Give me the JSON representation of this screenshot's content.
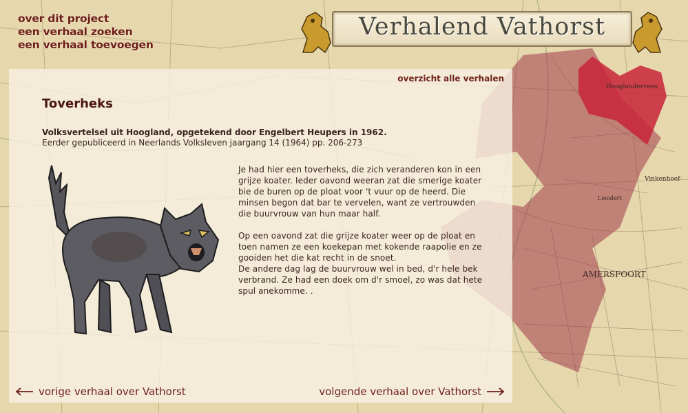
{
  "nav": {
    "items": [
      "over dit project",
      "een verhaal zoeken",
      "een verhaal toevoegen"
    ]
  },
  "logo": {
    "title": "Verhalend Vathorst"
  },
  "panel": {
    "overview_link": "overzicht alle verhalen",
    "title": "Toverheks",
    "subtitle_bold": "Volksvertelsel uit Hoogland, opgetekend door Engelbert Heupers in 1962.",
    "subtitle_plain": "Eerder gepubliceerd in Neerlands Volksleven jaargang 14 (1964) pp. 206-273",
    "story": [
      "Je had hier een toverheks, die zich veranderen kon in een grijze koater. Ieder oavond weeran zat die smerige koater bie de buren op de ploat voor 't vuur op de heerd. Die minsen begon dat bar te vervelen, want ze vertrouwden die buurvrouw van hun maar half.",
      "Op een oavond zat die grijze koater weer op de ploat en toen namen ze een koekepan met kokende raapolie en ze gooiden het die kat recht in de snoet.",
      "De andere dag lag de buurvrouw wel in bed, d'r hele bek verbrand. Ze had een doek om d'r smoel, zo was dat hete spul anekomme. ."
    ],
    "prev_link": "vorige verhaal over Vathorst",
    "next_link": "volgende verhaal over Vathorst"
  },
  "map_labels": [
    "Hooglanderveen",
    "Vinkenhoef",
    "Liendert",
    "AMERSFOORT"
  ],
  "colors": {
    "accent": "#6e1f1a",
    "region": "#a03a4a",
    "highlight": "#c8243a",
    "panel": "#f7f1e2"
  },
  "icons": [
    "left-arrow-icon",
    "right-arrow-icon",
    "lion-icon",
    "cat-illustration"
  ]
}
